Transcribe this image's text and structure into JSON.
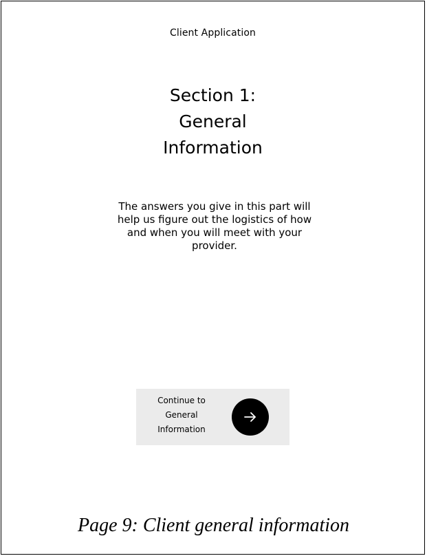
{
  "header": {
    "title": "Client Application"
  },
  "section": {
    "title_lines": [
      "Section 1:",
      "General",
      "Information"
    ],
    "description": "The answers you give in this part will help us figure out the logistics of how and when you will meet with your provider."
  },
  "continue_button": {
    "label_lines": [
      "Continue to",
      "General",
      "Information"
    ],
    "icon": "arrow-right-icon"
  },
  "caption": "Page 9: Client general information",
  "colors": {
    "button_background": "#ebebeb",
    "icon_circle": "#000000",
    "text": "#000000"
  }
}
